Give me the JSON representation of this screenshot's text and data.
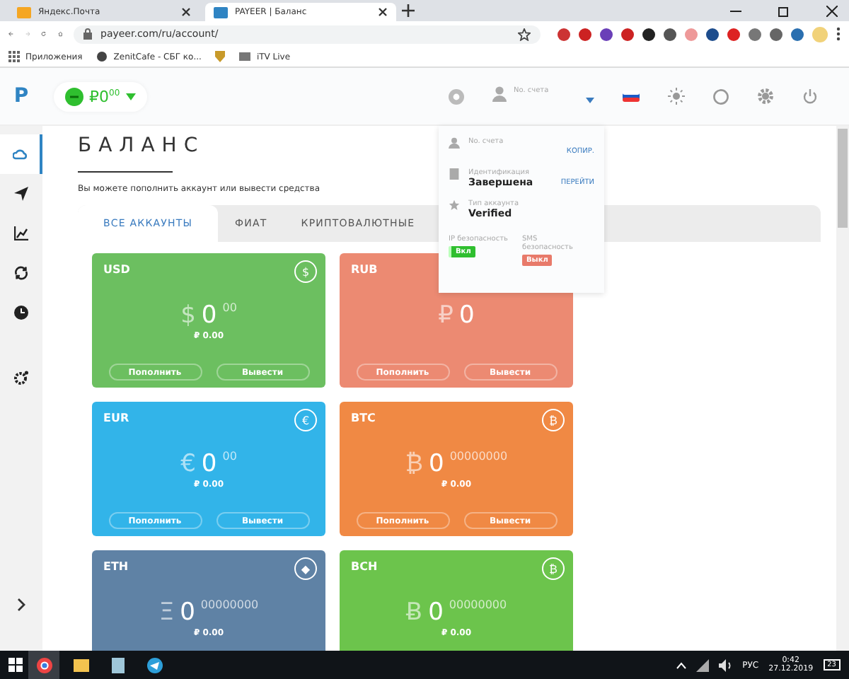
{
  "browser": {
    "tabs": [
      {
        "title": "Яндекс.Почта",
        "selected": false
      },
      {
        "title": "PAYEER | Баланс",
        "selected": true
      }
    ],
    "url": "payeer.com/ru/account/",
    "bookmarks": [
      "Приложения",
      "ZenitCafe - СБГ ко...",
      "iTV Live"
    ]
  },
  "header": {
    "logo": "P",
    "balance": "₽0$^{00}$",
    "account_label": "No. счета"
  },
  "sidebar": {
    "items": [
      {
        "kind": "home",
        "selected": true
      },
      {
        "kind": "send",
        "selected": false
      },
      {
        "kind": "chart",
        "selected": false
      },
      {
        "kind": "exchange",
        "selected": false
      },
      {
        "kind": "history",
        "selected": false
      },
      {
        "kind": "settings",
        "selected": false
      }
    ]
  },
  "page": {
    "title": "БАЛАНС",
    "description": "Вы можете пополнить аккаунт или вывести средства"
  },
  "tabs": [
    {
      "label": "ВСЕ АККАУНТЫ",
      "selected": true
    },
    {
      "label": "ФИАТ",
      "selected": false
    },
    {
      "label": "КРИПТОВАЛЮТНЫЕ",
      "selected": false
    }
  ],
  "accounts": [
    {
      "code": "USD",
      "color": "#6cbf60",
      "badge": "$",
      "symbol": "$",
      "amount": "0",
      "fraction": "00",
      "rub": "₽ 0.00",
      "buttons": [
        "Пополнить",
        "Вывести"
      ]
    },
    {
      "code": "RUB",
      "color": "#ec8a72",
      "symbol": "₽",
      "amount": "0",
      "buttons": [
        "Пополнить",
        "Вывести"
      ]
    },
    {
      "code": "EUR",
      "color": "#32b4e9",
      "badge": "€",
      "symbol": "€",
      "amount": "0",
      "fraction": "00",
      "rub": "₽ 0.00",
      "buttons": [
        "Пополнить",
        "Вывести"
      ]
    },
    {
      "code": "BTC",
      "color": "#f08944",
      "badge": "₿",
      "symbol": "₿",
      "amount": "0",
      "fraction": "00000000",
      "rub": "₽ 0.00",
      "buttons": [
        "Пополнить",
        "Вывести"
      ]
    },
    {
      "code": "ETH",
      "color": "#5f82a5",
      "badge": "◆",
      "symbol": "Ξ",
      "amount": "0",
      "fraction": "00000000",
      "rub": "₽ 0.00"
    },
    {
      "code": "BCH",
      "color": "#6cc44c",
      "badge": "₿",
      "symbol": "Ƀ",
      "amount": "0",
      "fraction": "00000000",
      "rub": "₽ 0.00"
    }
  ],
  "dropdown": {
    "rows": [
      {
        "kind": "account",
        "label": "No. счета",
        "link": "КОПИР."
      },
      {
        "kind": "identity",
        "label": "Идентификация",
        "value": "Завершена",
        "link": "ПЕРЕЙТИ"
      },
      {
        "kind": "type",
        "label": "Тип аккаунта",
        "value": "Verified"
      }
    ],
    "security": [
      {
        "label": "IP безопасность",
        "on": true,
        "state": "Вкл"
      },
      {
        "label": "SMS безопасность",
        "on": false,
        "state": "Выкл"
      }
    ]
  },
  "taskbar": {
    "language": "РУС",
    "time": "0:42",
    "date": "27.12.2019",
    "notifications": "23"
  }
}
